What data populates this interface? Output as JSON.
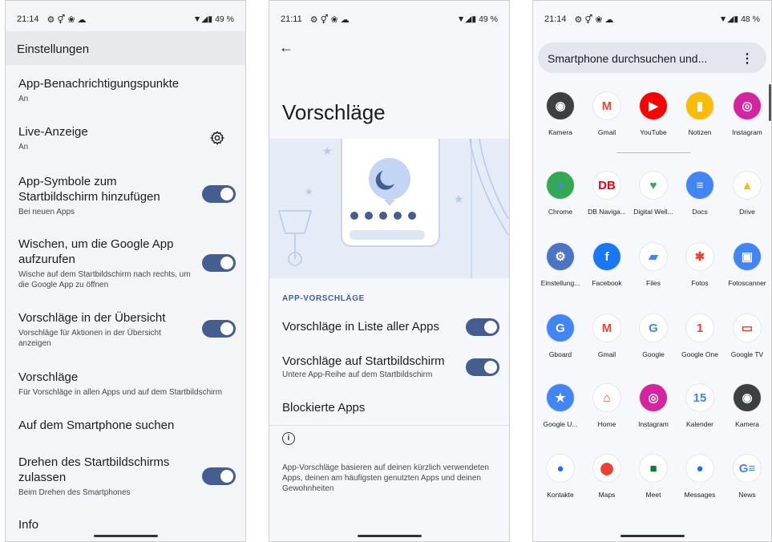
{
  "panel1": {
    "status": {
      "time": "21:14",
      "battery": "49 %"
    },
    "title": "Einstellungen",
    "rows": [
      {
        "title": "App-Benachrichtigungspunkte",
        "subtitle": "An"
      },
      {
        "title": "Live-Anzeige",
        "subtitle": "An"
      },
      {
        "title": "App-Symbole zum Startbildschirm hinzufügen",
        "subtitle": "Bei neuen Apps"
      },
      {
        "title": "Wischen, um die Google App aufzurufen",
        "subtitle": "Wische auf dem Startbildschirm nach rechts, um die Google App zu öffnen"
      },
      {
        "title": "Vorschläge in der Übersicht",
        "subtitle": "Vorschläge für Aktionen in der Übersicht anzeigen"
      },
      {
        "title": "Vorschläge",
        "subtitle": "Für Vorschläge in allen Apps und auf dem Startbildschirm"
      },
      {
        "title": "Auf dem Smartphone suchen",
        "subtitle": ""
      },
      {
        "title": "Drehen des Startbildschirms zulassen",
        "subtitle": "Beim Drehen des Smartphones"
      },
      {
        "title": "Info",
        "subtitle": ""
      }
    ]
  },
  "panel2": {
    "status": {
      "time": "21:11",
      "battery": "49 %"
    },
    "title": "Vorschläge",
    "section": "APP-VORSCHLÄGE",
    "rows": [
      {
        "title": "Vorschläge in Liste aller Apps",
        "subtitle": ""
      },
      {
        "title": "Vorschläge auf Startbildschirm",
        "subtitle": "Untere App-Reihe auf dem Startbildschirm"
      },
      {
        "title": "Blockierte Apps",
        "subtitle": ""
      }
    ],
    "info_icon": "i",
    "info": "App-Vorschläge basieren auf deinen kürzlich verwendeten Apps, deinen am häufigsten genutzten Apps und deinen Gewohnheiten"
  },
  "panel3": {
    "status": {
      "time": "21:14",
      "battery": "48 %"
    },
    "search_placeholder": "Smartphone durchsuchen und...",
    "menu_glyph": "⋮",
    "apps": [
      {
        "label": "Kamera",
        "icon": "camera-icon",
        "bg": "#3c4043",
        "fg": "#ffffff",
        "glyph": "◉"
      },
      {
        "label": "Gmail",
        "icon": "gmail-icon",
        "bg": "#ffffff",
        "fg": "#ea4335",
        "glyph": "M"
      },
      {
        "label": "YouTube",
        "icon": "youtube-icon",
        "bg": "#ff0000",
        "fg": "#ffffff",
        "glyph": "▶"
      },
      {
        "label": "Notizen",
        "icon": "keep-icon",
        "bg": "#fbbc04",
        "fg": "#ffffff",
        "glyph": "▮"
      },
      {
        "label": "Instagram",
        "icon": "instagram-icon",
        "bg": "#d6249f",
        "fg": "#ffffff",
        "glyph": "◎"
      },
      {
        "label": "Chrome",
        "icon": "chrome-icon",
        "bg": "#34a853",
        "fg": "#4285f4",
        "glyph": "●"
      },
      {
        "label": "DB Naviga...",
        "icon": "db-navigator-icon",
        "bg": "#ffffff",
        "fg": "#e30613",
        "glyph": "DB"
      },
      {
        "label": "Digital Well...",
        "icon": "digital-wellbeing-icon",
        "bg": "#ffffff",
        "fg": "#34a853",
        "glyph": "♥"
      },
      {
        "label": "Docs",
        "icon": "docs-icon",
        "bg": "#4285f4",
        "fg": "#ffffff",
        "glyph": "≡"
      },
      {
        "label": "Drive",
        "icon": "drive-icon",
        "bg": "#ffffff",
        "fg": "#fbbc04",
        "glyph": "▲"
      },
      {
        "label": "Einstellung...",
        "icon": "settings-icon",
        "bg": "#4b74c4",
        "fg": "#ffffff",
        "glyph": "⚙"
      },
      {
        "label": "Facebook",
        "icon": "facebook-icon",
        "bg": "#1877f2",
        "fg": "#ffffff",
        "glyph": "f"
      },
      {
        "label": "Files",
        "icon": "files-icon",
        "bg": "#ffffff",
        "fg": "#4285f4",
        "glyph": "▰"
      },
      {
        "label": "Fotos",
        "icon": "photos-icon",
        "bg": "#ffffff",
        "fg": "#ea4335",
        "glyph": "✱"
      },
      {
        "label": "Fotoscanner",
        "icon": "photoscan-icon",
        "bg": "#4285f4",
        "fg": "#ffffff",
        "glyph": "▣"
      },
      {
        "label": "Gboard",
        "icon": "gboard-icon",
        "bg": "#4285f4",
        "fg": "#ffffff",
        "glyph": "G"
      },
      {
        "label": "Gmail",
        "icon": "gmail-icon",
        "bg": "#ffffff",
        "fg": "#ea4335",
        "glyph": "M"
      },
      {
        "label": "Google",
        "icon": "google-icon",
        "bg": "#ffffff",
        "fg": "#4285f4",
        "glyph": "G"
      },
      {
        "label": "Google One",
        "icon": "google-one-icon",
        "bg": "#ffffff",
        "fg": "#ea4335",
        "glyph": "1"
      },
      {
        "label": "Google TV",
        "icon": "google-tv-icon",
        "bg": "#ffffff",
        "fg": "#ea4335",
        "glyph": "▭"
      },
      {
        "label": "Google U...",
        "icon": "google-rewards-icon",
        "bg": "#4285f4",
        "fg": "#ffffff",
        "glyph": "★"
      },
      {
        "label": "Home",
        "icon": "home-icon",
        "bg": "#ffffff",
        "fg": "#ea4335",
        "glyph": "⌂"
      },
      {
        "label": "Instagram",
        "icon": "instagram-icon",
        "bg": "#d6249f",
        "fg": "#ffffff",
        "glyph": "◎"
      },
      {
        "label": "Kalender",
        "icon": "calendar-icon",
        "bg": "#ffffff",
        "fg": "#4285f4",
        "glyph": "15"
      },
      {
        "label": "Kamera",
        "icon": "camera-icon",
        "bg": "#3c4043",
        "fg": "#ffffff",
        "glyph": "◉"
      },
      {
        "label": "Kontakte",
        "icon": "contacts-icon",
        "bg": "#ffffff",
        "fg": "#1a73e8",
        "glyph": "●"
      },
      {
        "label": "Maps",
        "icon": "maps-icon",
        "bg": "#ffffff",
        "fg": "#ea4335",
        "glyph": "⬤"
      },
      {
        "label": "Meet",
        "icon": "meet-icon",
        "bg": "#ffffff",
        "fg": "#00832d",
        "glyph": "■"
      },
      {
        "label": "Messages",
        "icon": "messages-icon",
        "bg": "#ffffff",
        "fg": "#1a73e8",
        "glyph": "●"
      },
      {
        "label": "News",
        "icon": "news-icon",
        "bg": "#ffffff",
        "fg": "#4285f4",
        "glyph": "G≡"
      }
    ]
  },
  "colors": {
    "toggle": "#445e91",
    "accent": "#445e91"
  }
}
